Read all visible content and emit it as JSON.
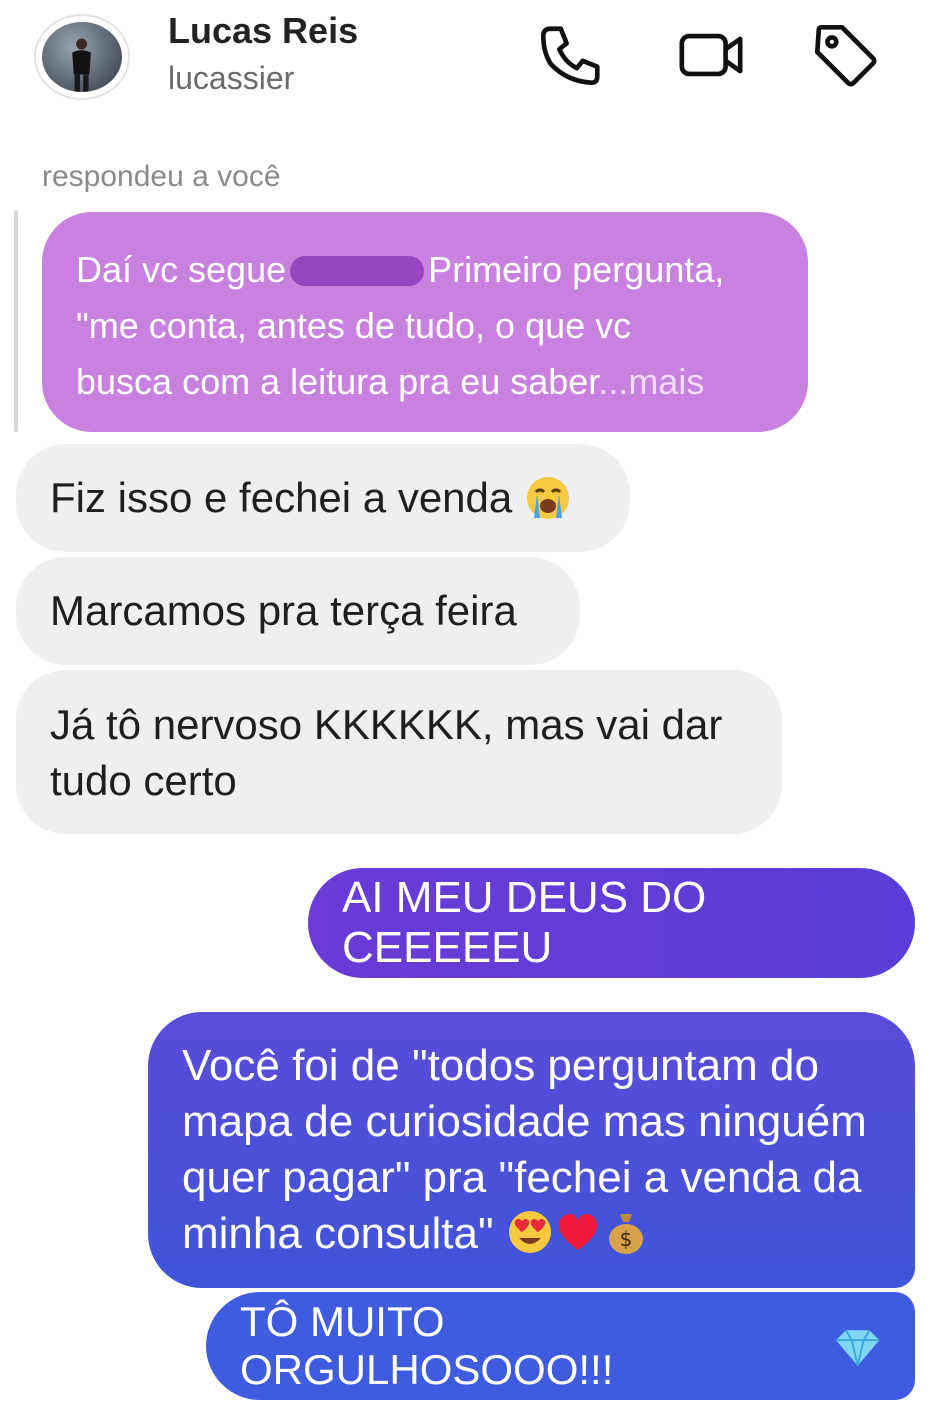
{
  "header": {
    "name": "Lucas Reis",
    "handle": "lucassier"
  },
  "reply": {
    "label": "respondeu a você",
    "line1_before": "Daí vc segue",
    "line1_after": "Primeiro pergunta,",
    "line2": "\"me conta, antes de tudo, o que vc",
    "line3": "busca com a leitura pra eu saber",
    "more": "...mais"
  },
  "incoming": [
    {
      "text": "Fiz isso e fechei a venda",
      "emoji": "loudly-crying-face"
    },
    {
      "text": "Marcamos pra terça feira"
    },
    {
      "text": "Já tô nervoso KKKKKK, mas vai dar tudo certo"
    }
  ],
  "outgoing": [
    {
      "text": "AI MEU DEUS DO CEEEEEU"
    },
    {
      "text": "Você foi de \"todos perguntam do mapa de curiosidade mas ninguém quer pagar\" pra \"fechei a venda da minha consulta\"",
      "emojis": [
        "heart-eyes",
        "red-heart",
        "money-bag"
      ]
    },
    {
      "text": "TÔ MUITO ORGULHOSOOO!!!",
      "emoji": "gem-stone"
    }
  ],
  "icons": [
    "phone-icon",
    "video-call-icon",
    "tag-icon"
  ],
  "colors": {
    "reply_bubble": "#c881de",
    "incoming_bubble": "#efefef",
    "outgoing_top": "#6a3bd6",
    "outgoing_bottom": "#3f5be0"
  }
}
